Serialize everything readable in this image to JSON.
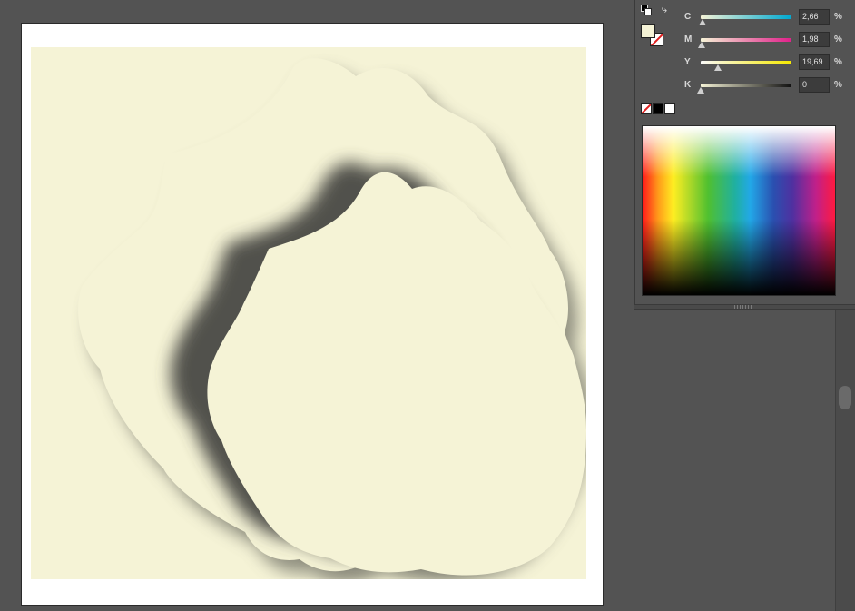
{
  "document": {
    "background": "#ffffff",
    "fill_color": "#f5f3d6"
  },
  "color_panel": {
    "channels": [
      {
        "label": "C",
        "value": "2,66",
        "unit": "%",
        "level": 0.0266
      },
      {
        "label": "M",
        "value": "1,98",
        "unit": "%",
        "level": 0.0198
      },
      {
        "label": "Y",
        "value": "19,69",
        "unit": "%",
        "level": 0.1969
      },
      {
        "label": "K",
        "value": "0",
        "unit": "%",
        "level": 0
      }
    ],
    "fill_swatch_color": "#f5f3d6",
    "icons": [
      "default-colors-icon",
      "swap-colors-icon",
      "none-swatch-icon"
    ]
  }
}
